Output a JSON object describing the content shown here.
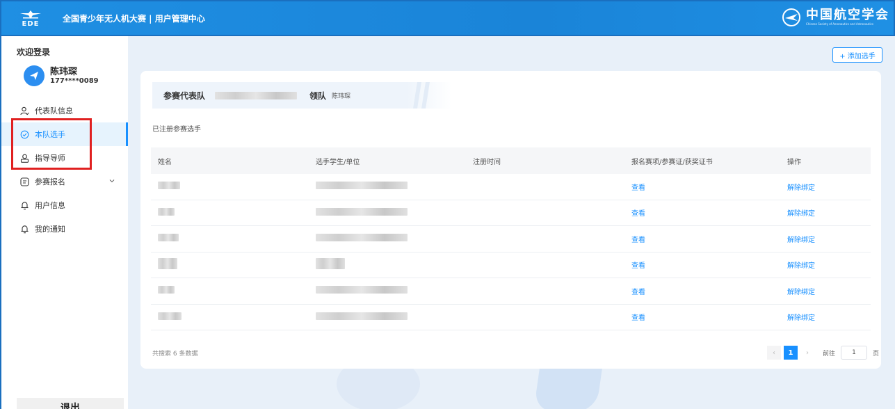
{
  "header": {
    "logo_text": "EDE",
    "app_title": "全国青少年无人机大赛 | 用户管理中心",
    "org_name": "中国航空学会",
    "org_english": "Chinese Society of Aeronautics and Astronautics"
  },
  "sidebar": {
    "welcome": "欢迎登录",
    "user_name": "陈玮琛",
    "user_phone": "177****0089",
    "items": [
      {
        "label": "代表队信息",
        "icon": "user-check-icon"
      },
      {
        "label": "本队选手",
        "icon": "check-circle-icon",
        "active": true
      },
      {
        "label": "指导导师",
        "icon": "users-icon"
      },
      {
        "label": "参赛报名",
        "icon": "form-icon",
        "has_submenu": true
      },
      {
        "label": "用户信息",
        "icon": "bell-icon"
      },
      {
        "label": "我的通知",
        "icon": "bell-icon"
      }
    ],
    "logout": "退出"
  },
  "main": {
    "add_button": "+ 添加选手",
    "team_label": "参赛代表队",
    "leader_label": "领队",
    "leader_name": "陈玮琛",
    "section_title": "已注册参赛选手",
    "columns": [
      "姓名",
      "选手学生/单位",
      "注册时间",
      "报名赛项/参赛证/获奖证书",
      "操作"
    ],
    "rows": [
      {
        "view": "查看",
        "action": "解除绑定"
      },
      {
        "view": "查看",
        "action": "解除绑定"
      },
      {
        "view": "查看",
        "action": "解除绑定"
      },
      {
        "view": "查看",
        "action": "解除绑定"
      },
      {
        "view": "查看",
        "action": "解除绑定"
      },
      {
        "view": "查看",
        "action": "解除绑定"
      }
    ],
    "total_text": "共搜索 6 条数据",
    "current_page": "1",
    "goto_label": "前往",
    "goto_value": "1",
    "page_suffix": "页"
  },
  "colors": {
    "brand": "#1f8fe3",
    "accent": "#1890ff",
    "highlight_box": "#e02020"
  }
}
